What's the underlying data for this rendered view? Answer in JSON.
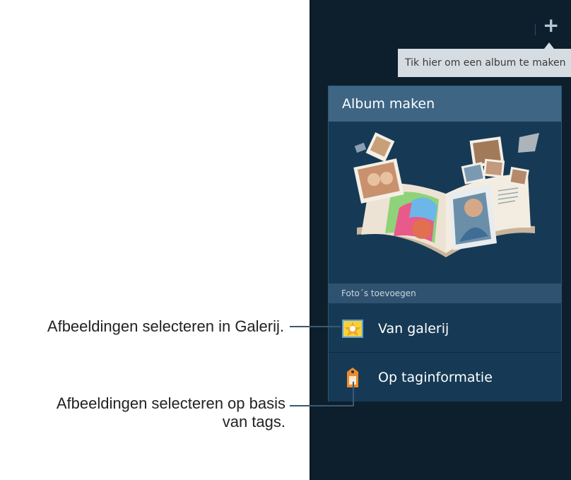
{
  "action_bar": {
    "add_icon": "plus-icon"
  },
  "tooltip": {
    "text": "Tik hier om een album te maken"
  },
  "dialog": {
    "title": "Album maken",
    "illustration_icon": "photo-book-illustration",
    "section_header": "Foto´s toevoegen",
    "items": [
      {
        "label": "Van galerij",
        "icon": "gallery-icon"
      },
      {
        "label": "Op taginformatie",
        "icon": "tag-icon"
      }
    ]
  },
  "callouts": {
    "gallery": "Afbeeldingen selecteren in Galerij.",
    "tags_line1": "Afbeeldingen selecteren op basis",
    "tags_line2": "van tags."
  },
  "colors": {
    "screen_bg": "#0d1f2d",
    "dialog_bg": "#163a55",
    "title_bar": "#3e6584",
    "tooltip_bg": "#d6dde2"
  }
}
